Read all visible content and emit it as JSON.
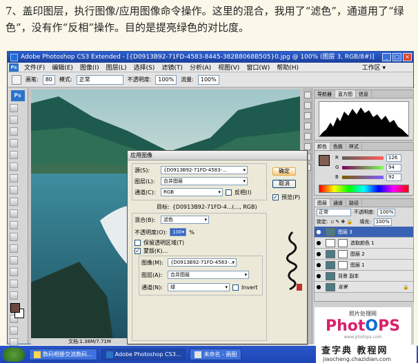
{
  "intro": "7、盖印图层，执行图像/应用图像命令操作。这里的混合，我用了“滤色”，通道用了“绿色”，没有作“反相”操作。目的是提亮绿色的对比度。",
  "window": {
    "title": "Adobe Photoshop CS3 Extended - [{D0913B92-71FD-4583-8445-382B8068B505}0.jpg @ 100% (图层 3, RGB/8#)]",
    "controls": [
      "_",
      "□",
      "×"
    ]
  },
  "menu": {
    "items": [
      "文件(F)",
      "编辑(E)",
      "图像(I)",
      "图层(L)",
      "选择(S)",
      "滤镜(T)",
      "分析(A)",
      "视图(V)",
      "窗口(W)",
      "帮助(H)"
    ],
    "workspace": "工作区 ▾"
  },
  "options": {
    "brush_label": "画笔:",
    "brush_size": "80",
    "mode_label": "模式:",
    "mode_value": "正常",
    "opacity_label": "不透明度:",
    "opacity_value": "100%",
    "flow_label": "流量:",
    "flow_value": "100%"
  },
  "status": {
    "doc": "文档:1.38M/7.71M"
  },
  "panels": {
    "nav_tabs": [
      "导航器",
      "直方图",
      "信息"
    ],
    "color_tabs": [
      "颜色",
      "色板",
      "样式"
    ],
    "color": {
      "r_label": "R",
      "r": "126",
      "g_label": "G",
      "g": "94",
      "b_label": "B",
      "b": "92"
    },
    "layers_tabs": [
      "图层",
      "通道",
      "路径"
    ],
    "blend": "正常",
    "opacity_label": "不透明度:",
    "opacity": "100%",
    "lock_label": "锁定:",
    "fill_label": "填充:",
    "fill": "100%",
    "layers": [
      {
        "name": "图层 3"
      },
      {
        "name": "选取颜色 1"
      },
      {
        "name": "图层 2"
      },
      {
        "name": "图层 1"
      },
      {
        "name": "背景 副本"
      },
      {
        "name": "背景"
      }
    ]
  },
  "dialog": {
    "title": "应用图像",
    "source_label": "源(S):",
    "source": "{D0913B92-71FD-4583-...",
    "layer_label": "图层(L):",
    "layer": "合并图层",
    "channel_label": "通道(C):",
    "channel": "RGB",
    "invert_label": "反相(I)",
    "target_label": "目标:",
    "target": "{D0913B92-71FD-4...(..., RGB)",
    "blending_label": "混合(B):",
    "blending": "滤色",
    "opacity_label": "不透明度(O):",
    "opacity": "100",
    "pct": "%",
    "preserve_label": "保留透明区域(T)",
    "mask_label": "蒙版(K)...",
    "image_label": "图像(M):",
    "image": "{D0913B92-71FD-4583-...",
    "mask_layer_label": "图层(A):",
    "mask_layer": "合并图层",
    "mask_channel_label": "通道(N):",
    "mask_channel": "绿",
    "mask_invert_label": "Invert",
    "ok": "确定",
    "cancel": "取消",
    "preview_label": "预览(P)"
  },
  "watermark": {
    "top": "照片处理网",
    "brand_a": "Phot",
    "brand_b": "PS",
    "url": "www.photops.com"
  },
  "taskbar": {
    "tasks": [
      "数码相册交流数码...",
      "Adobe Photoshop CS3...",
      "未命名 - 画图"
    ]
  },
  "site": {
    "name": "查字典 教程网",
    "url": "jiaocheng.chazidian.com"
  }
}
